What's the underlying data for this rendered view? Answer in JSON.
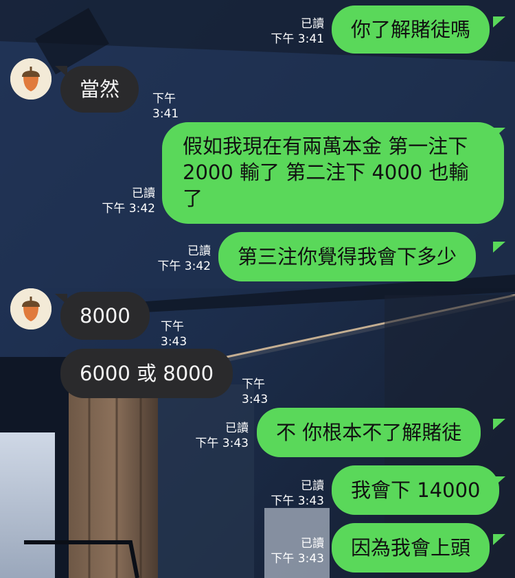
{
  "chat": {
    "messages": [
      {
        "text": "你了解賭徒嗎",
        "read": "已讀",
        "time": "下午 3:41"
      },
      {
        "text": "當然",
        "time": "下午 3:41"
      },
      {
        "text": "假如我現在有兩萬本金 第一注下 2000 輸了 第二注下 4000 也輸了",
        "read": "已讀",
        "time": "下午 3:42"
      },
      {
        "text": "第三注你覺得我會下多少",
        "read": "已讀",
        "time": "下午 3:42"
      },
      {
        "text": "8000",
        "time": "下午 3:43"
      },
      {
        "text": "6000 或 8000",
        "time": "下午 3:43"
      },
      {
        "text": "不 你根本不了解賭徒",
        "read": "已讀",
        "time": "下午 3:43"
      },
      {
        "text": "我會下 14000",
        "read": "已讀",
        "time": "下午 3:43"
      },
      {
        "text": "因為我會上頭",
        "read": "已讀",
        "time": "下午 3:43"
      }
    ]
  },
  "colors": {
    "outgoing_bubble": "#5ad85a",
    "incoming_bubble": "#2a2a2c",
    "avatar_bg": "#f3ead7",
    "acorn_cap": "#6b4a2a",
    "acorn_body": "#e07a3c"
  },
  "icons": {
    "avatar": "acorn-icon"
  }
}
